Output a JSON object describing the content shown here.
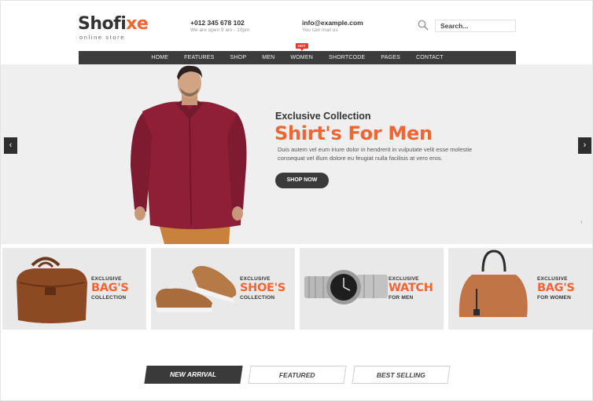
{
  "header": {
    "logo_main_prefix": "Shofi",
    "logo_main_accent": "xe",
    "logo_sub": "online store",
    "phone": "+012 345 678 102",
    "phone_sub": "We are open 9 am - 10pm",
    "email": "info@example.com",
    "email_sub": "You can mail us",
    "search_placeholder": "Search..."
  },
  "nav": {
    "items": [
      "HOME",
      "FEATURES",
      "SHOP",
      "MEN",
      "WOMEN",
      "SHORTCODE",
      "PAGES",
      "CONTACT"
    ],
    "hot_badge": "HOT"
  },
  "hero": {
    "subtitle": "Exclusive Collection",
    "title": "Shirt's For Men",
    "desc_line1": "Duis autem vel eum iriure dolor in hendrerit in vulputate velit esse molestie",
    "desc_line2": "consequat vel illum dolore eu feugiat nulla facilisis at vero eros.",
    "button": "SHOP NOW",
    "prev": "‹",
    "next": "›",
    "small_next": "›"
  },
  "cards": [
    {
      "t1": "EXCLUSIVE",
      "t2": "BAG'S",
      "t3": "COLLECTION"
    },
    {
      "t1": "EXCLUSIVE",
      "t2": "SHOE'S",
      "t3": "COLLECTION"
    },
    {
      "t1": "EXCLUSIVE",
      "t2": "WATCH",
      "t3": "FOR MEN"
    },
    {
      "t1": "EXCLUSIVE",
      "t2": "BAG'S",
      "t3": "FOR WOMEN"
    }
  ],
  "tabs": [
    "NEW ARRIVAL",
    "FEATURED",
    "BEST SELLING"
  ],
  "colors": {
    "accent": "#ef6533",
    "dark": "#3a3a3a",
    "hot": "#e8362a"
  }
}
